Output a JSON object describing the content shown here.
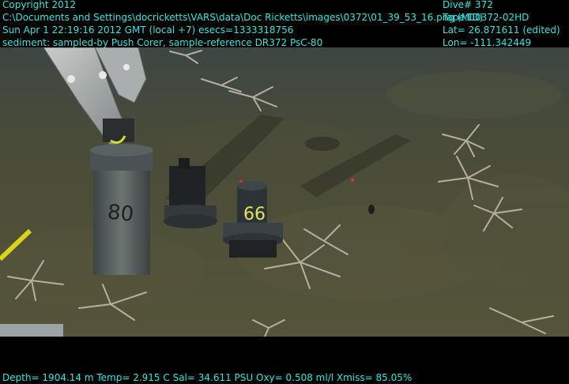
{
  "overlay": {
    "copyright": "Copyright 2012",
    "path": "C:\\Documents and Settings\\docricketts\\VARS\\data\\Doc Ricketts\\images\\0372\\01_39_53_16.png (MID)",
    "datetime": "Sun Apr  1 22:19:16 2012 GMT (local +7)  esecs=1333318756",
    "sample": "sediment: sampled-by Push Corer, sample-reference DR372 PsC-80",
    "dive": "Dive# 372",
    "tape": "Tape:D0372-02HD",
    "lat": "Lat= 26.871611 (edited)",
    "lon": "Lon= -111.342449",
    "telemetry": "Depth= 1904.14 m  Temp= 2.915 C  Sal= 34.611 PSU  Oxy= 0.508 ml/l  Xmiss= 85.05%"
  },
  "scene": {
    "core_labels": [
      "80",
      "66"
    ],
    "colors": {
      "overlay_text": "#2fe6e0",
      "seafloor": "#4b4a33",
      "water": "#3c4440"
    }
  }
}
